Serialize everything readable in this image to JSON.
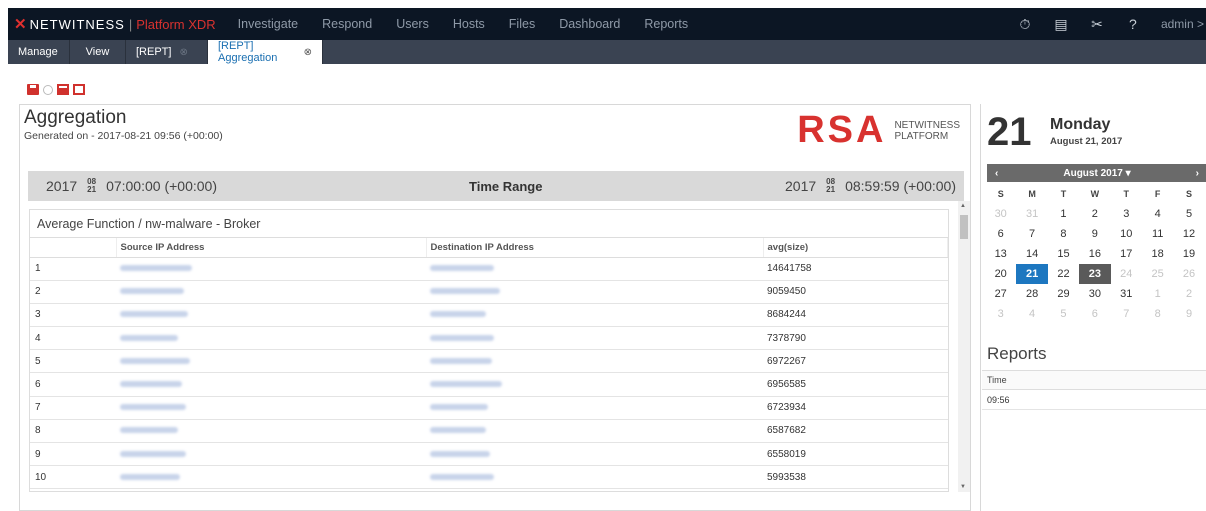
{
  "brand": {
    "name": "NETWITNESS",
    "separator": "|",
    "product": "Platform XDR"
  },
  "nav": [
    "Investigate",
    "Respond",
    "Users",
    "Hosts",
    "Files",
    "Dashboard",
    "Reports"
  ],
  "user": {
    "name": "admin",
    "chevron": ">"
  },
  "top_icons": [
    "timer-icon",
    "notes-icon",
    "tools-icon",
    "help-icon"
  ],
  "tabs": [
    {
      "label": "Manage"
    },
    {
      "label": "View"
    },
    {
      "label": "[REPT]"
    },
    {
      "label": "[REPT] Aggregation",
      "active": true
    }
  ],
  "report": {
    "title": "Aggregation",
    "generated": "Generated on - 2017-08-21 09:56 (+00:00)",
    "logo": {
      "rsa": "RSA",
      "line1": "NETWITNESS",
      "line2": "PLATFORM"
    },
    "time_range": {
      "label": "Time Range",
      "start": {
        "year": "2017",
        "month": "08",
        "day": "21",
        "time": "07:00:00 (+00:00)"
      },
      "end": {
        "year": "2017",
        "month": "08",
        "day": "21",
        "time": "08:59:59 (+00:00)"
      }
    },
    "grid": {
      "title": "Average Function / nw-malware - Broker",
      "columns": [
        "",
        "Source IP Address",
        "Destination IP Address",
        "avg(size)"
      ],
      "rows": [
        {
          "n": "1",
          "avg": "14641758"
        },
        {
          "n": "2",
          "avg": "9059450"
        },
        {
          "n": "3",
          "avg": "8684244"
        },
        {
          "n": "4",
          "avg": "7378790"
        },
        {
          "n": "5",
          "avg": "6972267"
        },
        {
          "n": "6",
          "avg": "6956585"
        },
        {
          "n": "7",
          "avg": "6723934"
        },
        {
          "n": "8",
          "avg": "6587682"
        },
        {
          "n": "9",
          "avg": "6558019"
        },
        {
          "n": "10",
          "avg": "5993538"
        }
      ]
    }
  },
  "calendar": {
    "day": "21",
    "weekday": "Monday",
    "date": "August 21, 2017",
    "month_label": "August 2017",
    "prev": "‹",
    "next": "›",
    "dropdown": "▾",
    "weekdays": [
      "S",
      "M",
      "T",
      "W",
      "T",
      "F",
      "S"
    ],
    "weeks": [
      [
        "30",
        "31",
        "1",
        "2",
        "3",
        "4",
        "5"
      ],
      [
        "6",
        "7",
        "8",
        "9",
        "10",
        "11",
        "12"
      ],
      [
        "13",
        "14",
        "15",
        "16",
        "17",
        "18",
        "19"
      ],
      [
        "20",
        "21",
        "22",
        "23",
        "24",
        "25",
        "26"
      ],
      [
        "27",
        "28",
        "29",
        "30",
        "31",
        "1",
        "2"
      ],
      [
        "3",
        "4",
        "5",
        "6",
        "7",
        "8",
        "9"
      ]
    ]
  },
  "reports_panel": {
    "title": "Reports",
    "column": "Time",
    "rows": [
      "09:56"
    ]
  }
}
